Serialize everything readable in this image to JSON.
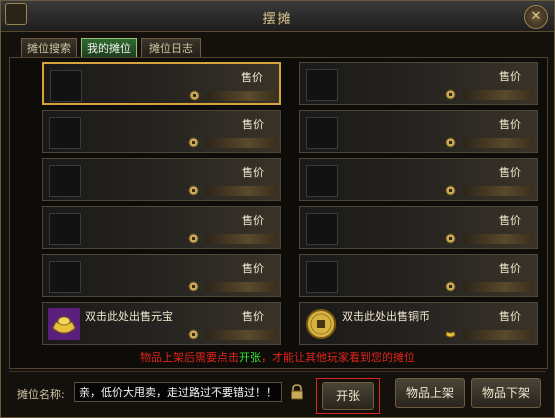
{
  "window": {
    "title": "摆摊",
    "close_symbol": "✕"
  },
  "tabs": [
    {
      "label": "摊位搜索",
      "active": false
    },
    {
      "label": "我的摊位",
      "active": true
    },
    {
      "label": "摊位日志",
      "active": false
    }
  ],
  "slots": {
    "price_label": "售价",
    "left": [
      {
        "item": "",
        "selected": true
      },
      {
        "item": ""
      },
      {
        "item": ""
      },
      {
        "item": ""
      },
      {
        "item": ""
      }
    ],
    "right": [
      {
        "item": ""
      },
      {
        "item": ""
      },
      {
        "item": ""
      },
      {
        "item": ""
      },
      {
        "item": ""
      }
    ],
    "special_left": {
      "text": "双击此处出售元宝",
      "icon": "gold-ingot-icon"
    },
    "special_right": {
      "text": "双击此处出售铜币",
      "icon": "copper-coin-icon"
    }
  },
  "notice": {
    "part1": "物品上架后需要点击",
    "highlight": "开张",
    "part2": "，才能让其他玩家看到您的摊位"
  },
  "stall_name": {
    "label": "摊位名称:",
    "value": "亲，低价大甩卖，走过路过不要错过！！！"
  },
  "buttons": {
    "open": "开张",
    "list_item": "物品上架",
    "delist_item": "物品下架"
  },
  "colors": {
    "accent": "#d7a33d",
    "notice": "#e0241c",
    "highlight": "#35e03a"
  }
}
